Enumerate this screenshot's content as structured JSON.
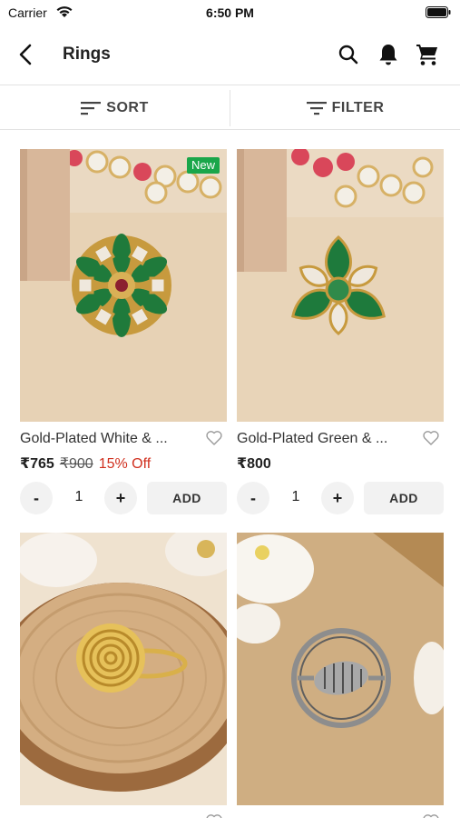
{
  "status_bar": {
    "carrier": "Carrier",
    "time": "6:50 PM"
  },
  "header": {
    "title": "Rings",
    "icons": [
      "back-arrow-icon",
      "search-icon",
      "bell-icon",
      "cart-icon"
    ]
  },
  "toolbar": {
    "sort_label": "SORT",
    "filter_label": "FILTER"
  },
  "colors": {
    "badge_green": "#1aa64a",
    "discount_red": "#d02f1e",
    "button_grey": "#f2f2f2"
  },
  "products": [
    {
      "name": "Gold-Plated White & ...",
      "price": "₹765",
      "mrp": "₹900",
      "discount": "15% Off",
      "badge": "New",
      "qty": "1",
      "add_label": "ADD",
      "minus": "-",
      "plus": "+"
    },
    {
      "name": "Gold-Plated Green & ...",
      "price": "₹800",
      "qty": "1",
      "add_label": "ADD",
      "minus": "-",
      "plus": "+"
    },
    {
      "name": ""
    },
    {
      "name": ""
    }
  ]
}
